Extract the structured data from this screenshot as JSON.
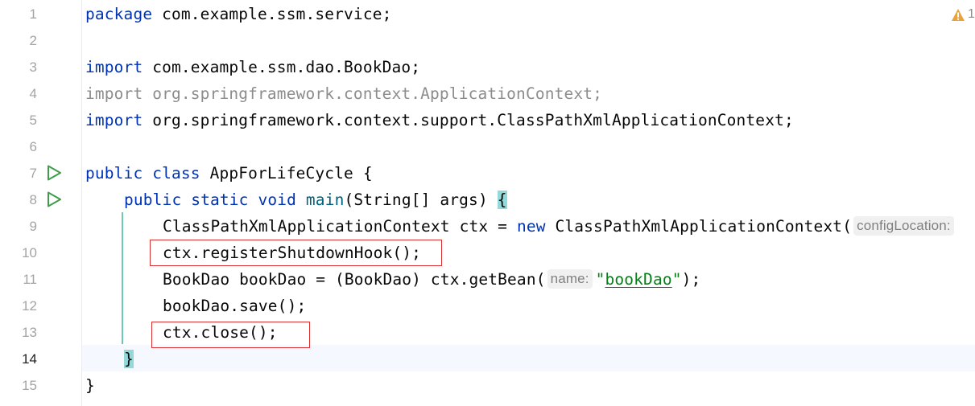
{
  "editor": {
    "active_line": "14",
    "warnings": {
      "icon": "warning-triangle-icon",
      "count": "1",
      "color": "#e8a33d"
    },
    "line_numbers": [
      "1",
      "2",
      "3",
      "4",
      "5",
      "6",
      "7",
      "8",
      "9",
      "10",
      "11",
      "12",
      "13",
      "14",
      "15"
    ],
    "run_gutter_icon": "run-triangle-icon",
    "code": {
      "l1": {
        "kw": "package",
        "rest": " com.example.ssm.service;"
      },
      "l3": {
        "kw": "import",
        "rest": " com.example.ssm.dao.BookDao;"
      },
      "l4": {
        "text": "import org.springframework.context.ApplicationContext;"
      },
      "l5": {
        "kw": "import",
        "rest": " org.springframework.context.support.ClassPathXmlApplicationContext;"
      },
      "l7": {
        "kw1": "public",
        "kw2": "class",
        "name": "AppForLifeCycle",
        "brace": "{"
      },
      "l8": {
        "kw1": "public",
        "kw2": "static",
        "kw3": "void",
        "method": "main",
        "params": "(String[] args) ",
        "brace": "{"
      },
      "l9": {
        "decl": "ClassPathXmlApplicationContext ctx = ",
        "kw": "new",
        "ctor": " ClassPathXmlApplicationContext(",
        "hint": "configLocation:"
      },
      "l10": {
        "text": "ctx.registerShutdownHook();"
      },
      "l11": {
        "pre": "BookDao bookDao = (BookDao) ctx.getBean(",
        "hint": "name:",
        "q1": "\"",
        "str": "bookDao",
        "q2": "\"",
        "post": ");"
      },
      "l12": {
        "text": "bookDao.save();"
      },
      "l13": {
        "text": "ctx.close();"
      },
      "l14": {
        "text": "}"
      },
      "l15": {
        "text": "}"
      }
    }
  }
}
